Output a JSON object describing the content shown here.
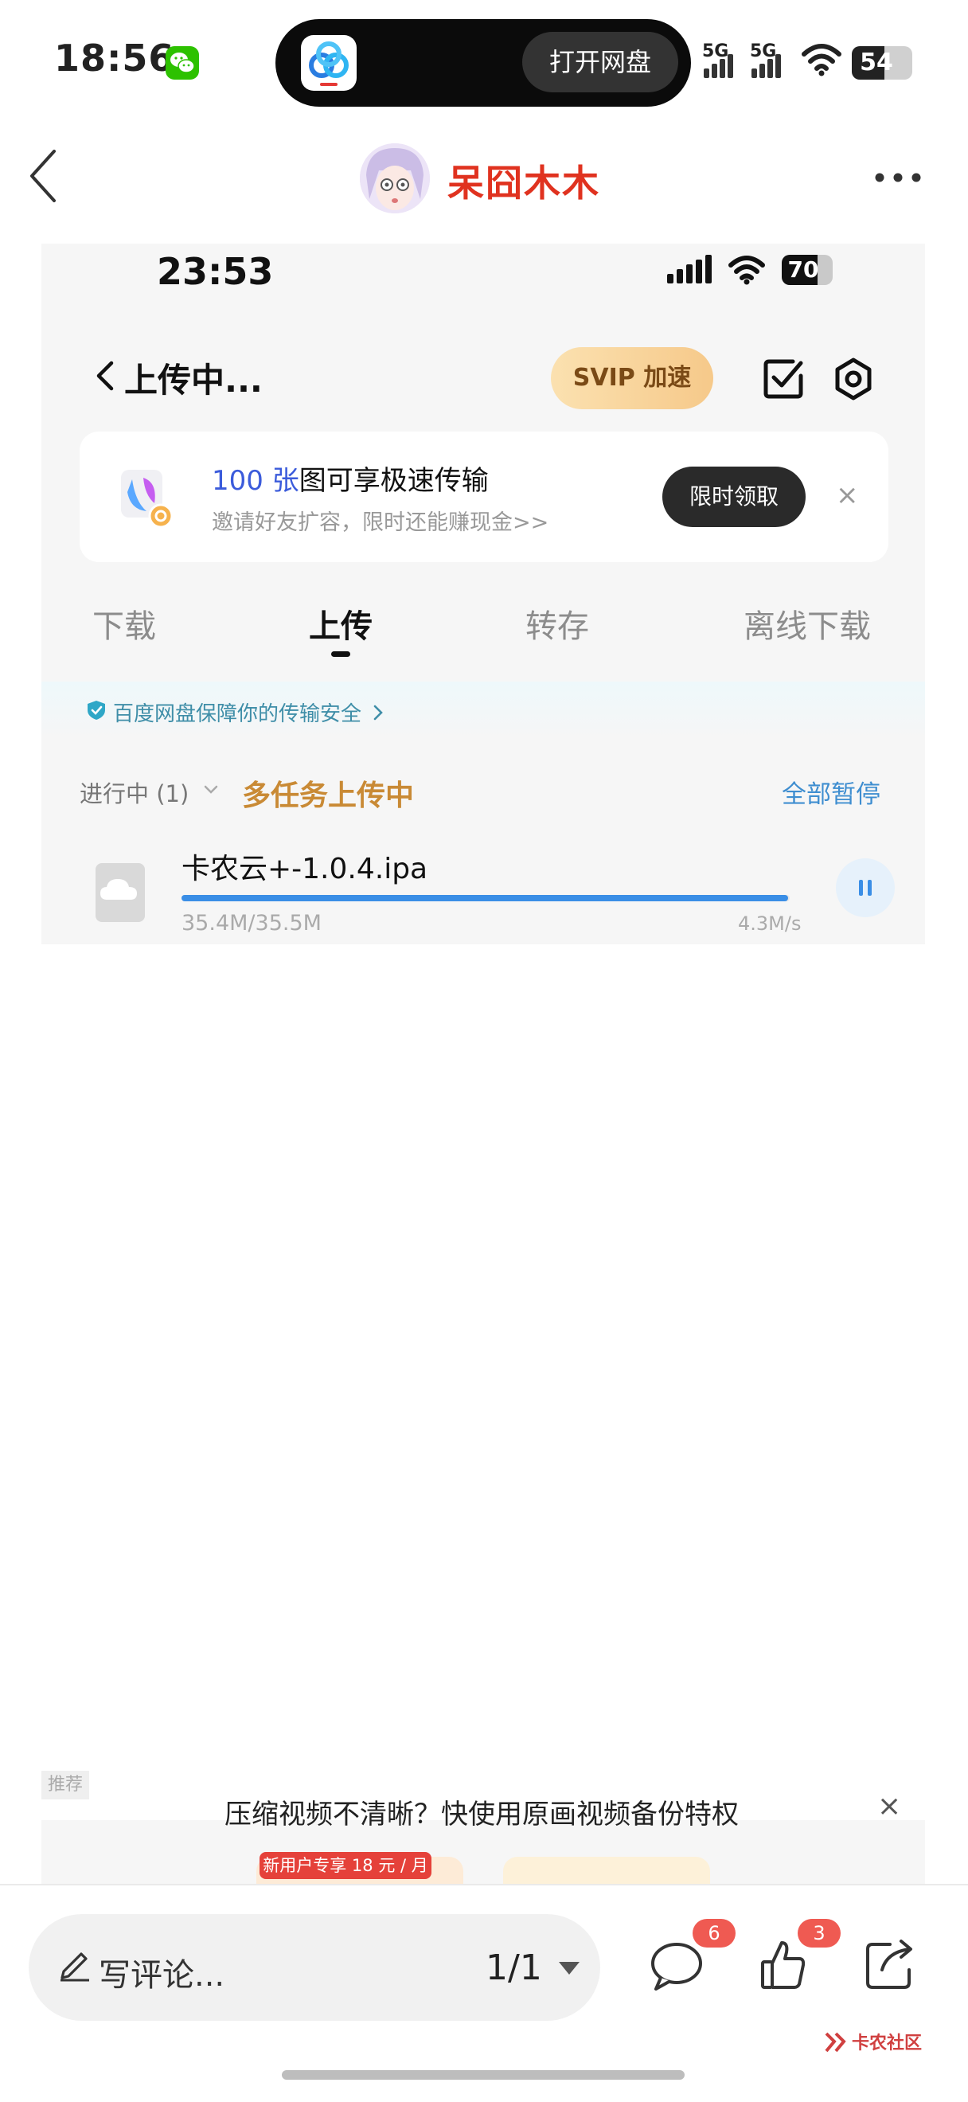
{
  "status_bar": {
    "time": "18:56",
    "dynamic_island_button": "打开网盘",
    "signal_1": "5G",
    "signal_2": "5G",
    "battery": "54",
    "battery_level": 0.54
  },
  "post_header": {
    "author": "呆囧木木"
  },
  "screenshot": {
    "status_time": "23:53",
    "battery": "70",
    "battery_level": 0.7,
    "page_title": "上传中...",
    "svip_button": "SVIP 加速",
    "promo": {
      "title_highlight": "100 张",
      "title_rest": "图可享极速传输",
      "subtitle": "邀请好友扩容，限时还能赚现金>>",
      "button": "限时领取",
      "close": "×"
    },
    "tabs": [
      {
        "label": "下载",
        "active": false
      },
      {
        "label": "上传",
        "active": true
      },
      {
        "label": "转存",
        "active": false
      },
      {
        "label": "离线下载",
        "active": false
      }
    ],
    "safety_notice": "百度网盘保障你的传输安全",
    "section": {
      "status": "进行中 (1)",
      "multi_task": "多任务上传中",
      "pause_all": "全部暂停"
    },
    "upload_item": {
      "file_name": "卡农云+-1.0.4.ipa",
      "size": "35.4M/35.5M",
      "speed": "4.3M/s",
      "progress": 0.997
    },
    "recommend": {
      "tag": "推荐",
      "text": "压缩视频不清晰？快使用原画视频备份特权",
      "close": "×",
      "pill_tag": "新用户专享 18 元 / 月"
    }
  },
  "bottom_bar": {
    "comment_placeholder": "写评论...",
    "page_indicator": "1/1",
    "comment_count": "6",
    "like_count": "3"
  },
  "watermark": "卡农社区",
  "colors": {
    "author_red": "#e0321f",
    "accent_blue": "#3a8ee6",
    "multi_task_orange": "#c98a35",
    "badge_red": "#ef5a52"
  }
}
